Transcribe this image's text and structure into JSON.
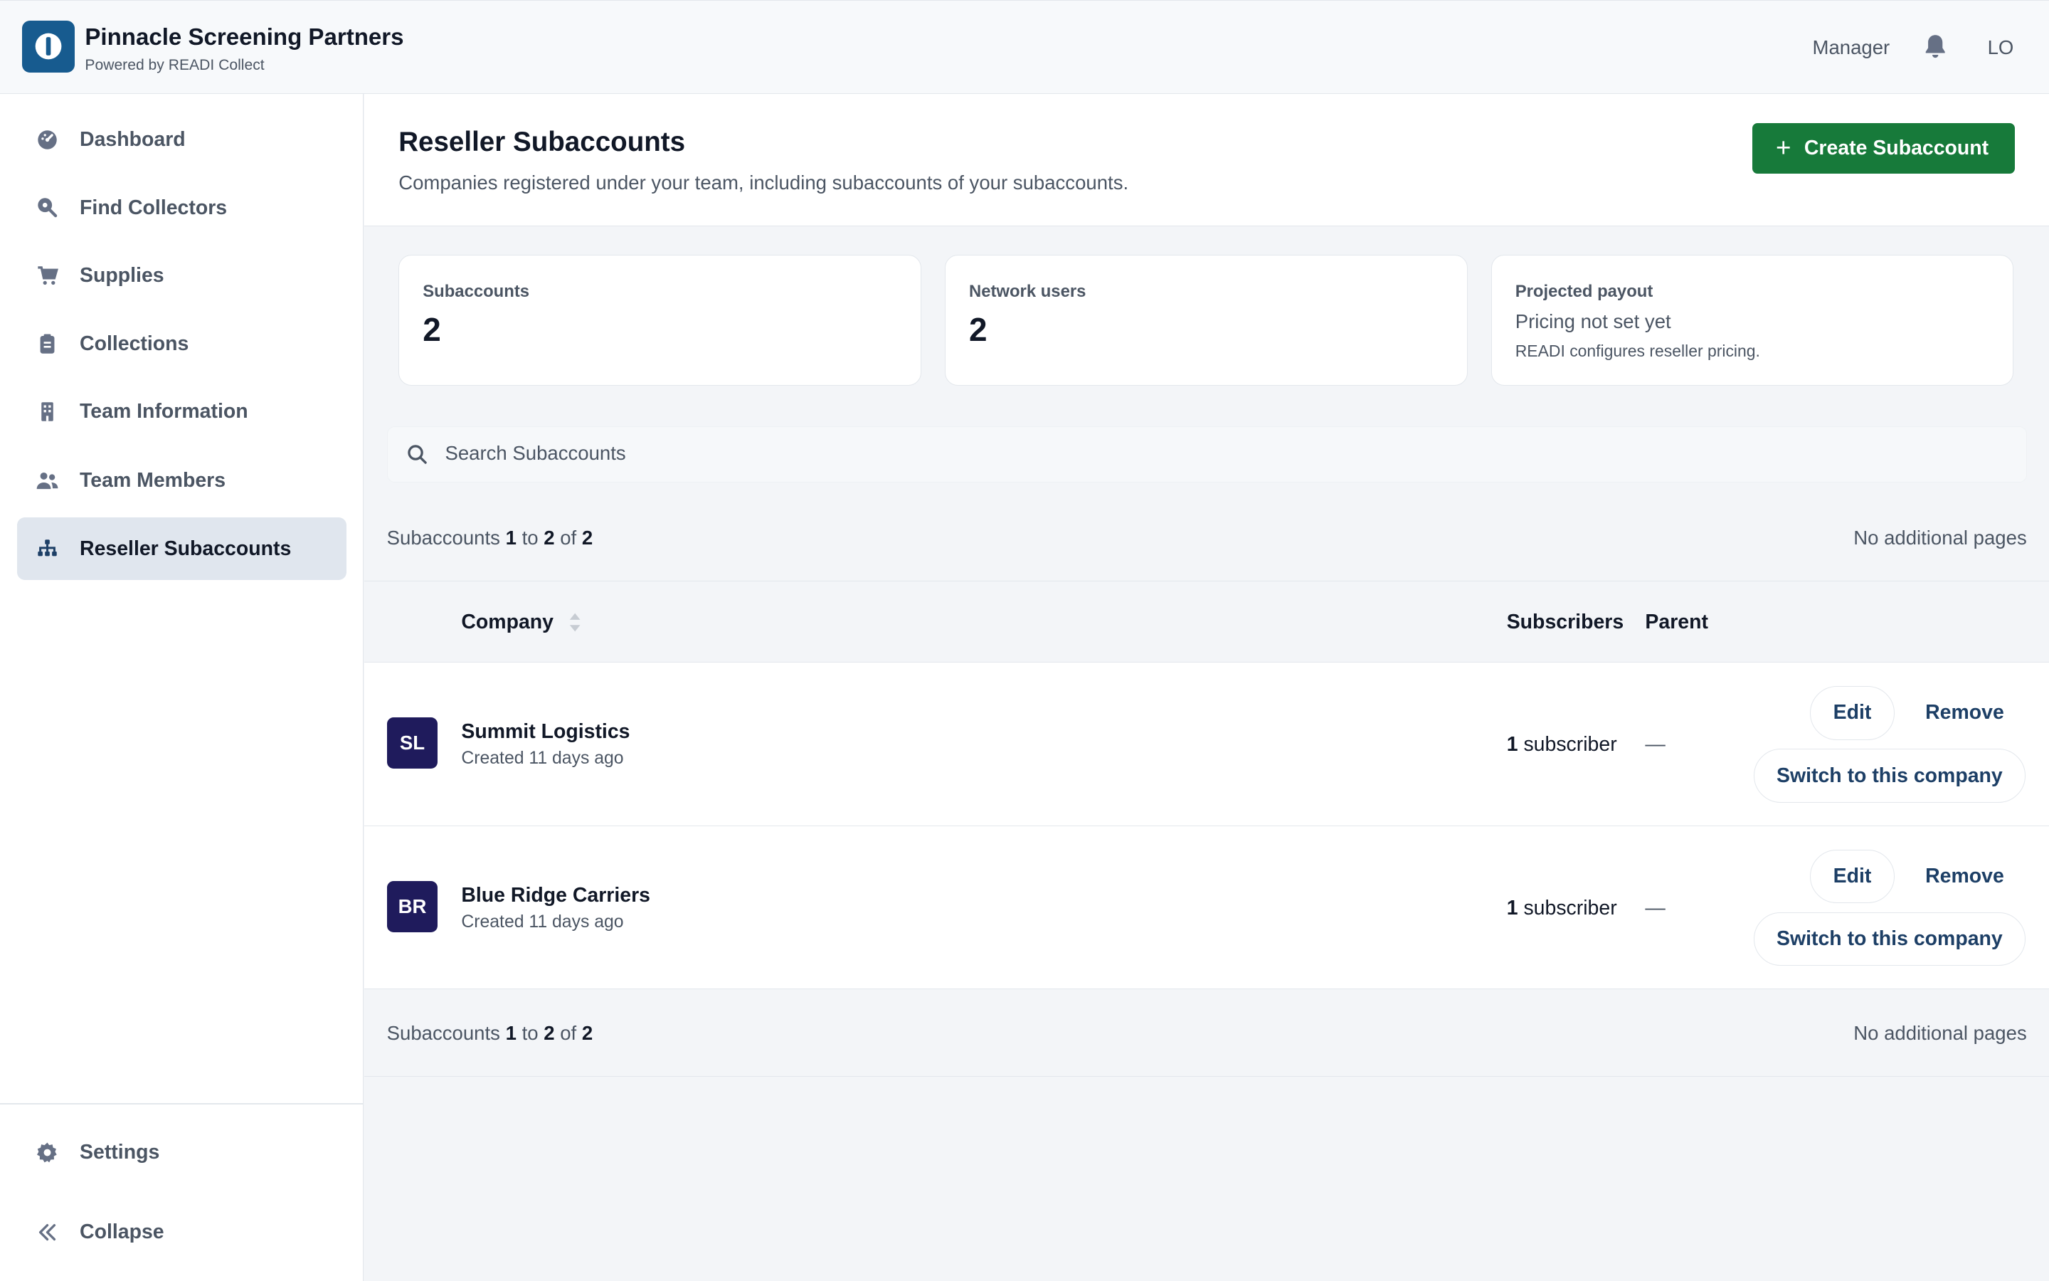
{
  "header": {
    "brand_title": "Pinnacle Screening Partners",
    "brand_subtitle": "Powered by READI Collect",
    "role": "Manager",
    "user_initials": "LO",
    "logo_icon": "brand-logo-icon",
    "notification_icon": "bell-icon"
  },
  "sidebar": {
    "items": [
      {
        "label": "Dashboard",
        "icon": "dashboard-icon"
      },
      {
        "label": "Find Collectors",
        "icon": "search-pin-icon"
      },
      {
        "label": "Supplies",
        "icon": "cart-icon"
      },
      {
        "label": "Collections",
        "icon": "clipboard-icon"
      },
      {
        "label": "Team Information",
        "icon": "building-icon"
      },
      {
        "label": "Team Members",
        "icon": "users-icon"
      },
      {
        "label": "Reseller Subaccounts",
        "icon": "hierarchy-icon",
        "active": true
      }
    ],
    "settings_label": "Settings",
    "collapse_label": "Collapse"
  },
  "page": {
    "title": "Reseller Subaccounts",
    "description": "Companies registered under your team, including subaccounts of your subaccounts.",
    "create_button": "Create Subaccount"
  },
  "stats": {
    "subaccounts_label": "Subaccounts",
    "subaccounts_value": "2",
    "network_users_label": "Network users",
    "network_users_value": "2",
    "payout_label": "Projected payout",
    "payout_value": "Pricing not set yet",
    "payout_note": "READI configures reseller pricing."
  },
  "search": {
    "placeholder": "Search Subaccounts",
    "value": ""
  },
  "pager": {
    "prefix": "Subaccounts",
    "start": "1",
    "to_word": "to",
    "end": "2",
    "of_word": "of",
    "total": "2",
    "right_text": "No additional pages"
  },
  "table": {
    "columns": {
      "company": "Company",
      "subscribers": "Subscribers",
      "parent": "Parent"
    },
    "rows": [
      {
        "initials": "SL",
        "name": "Summit Logistics",
        "created": "Created 11 days ago",
        "subscriber_count": "1",
        "subscriber_word": "subscriber",
        "parent": "—",
        "edit": "Edit",
        "remove": "Remove",
        "switch": "Switch to this company"
      },
      {
        "initials": "BR",
        "name": "Blue Ridge Carriers",
        "created": "Created 11 days ago",
        "subscriber_count": "1",
        "subscriber_word": "subscriber",
        "parent": "—",
        "edit": "Edit",
        "remove": "Remove",
        "switch": "Switch to this company"
      }
    ]
  },
  "colors": {
    "brand": "#175b8f",
    "primary_action": "#177a3a",
    "avatar": "#1f1b5c",
    "link": "#1d3f66"
  }
}
